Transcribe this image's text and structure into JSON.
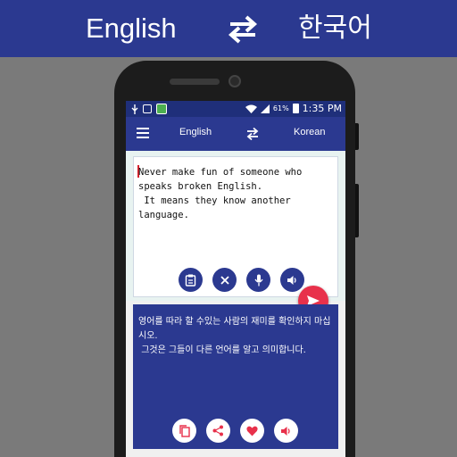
{
  "banner": {
    "source_language": "English",
    "target_language": "한국어",
    "swap_icon": "swap-arrows-icon"
  },
  "statusbar": {
    "battery_percent": "61%",
    "time": "1:35 PM"
  },
  "appbar": {
    "source_language": "English",
    "target_language": "Korean"
  },
  "input": {
    "text": "Never make fun of someone who speaks broken English.\n It means they know another language."
  },
  "output": {
    "text": "영어를 따라 할 수있는 사람의 재미를 확인하지 마십시오.\n 그것은 그들이 다른 언어를 알고 의미합니다."
  },
  "colors": {
    "primary": "#2b3990",
    "accent": "#e8314b",
    "statusbar": "#1f2f7a"
  }
}
